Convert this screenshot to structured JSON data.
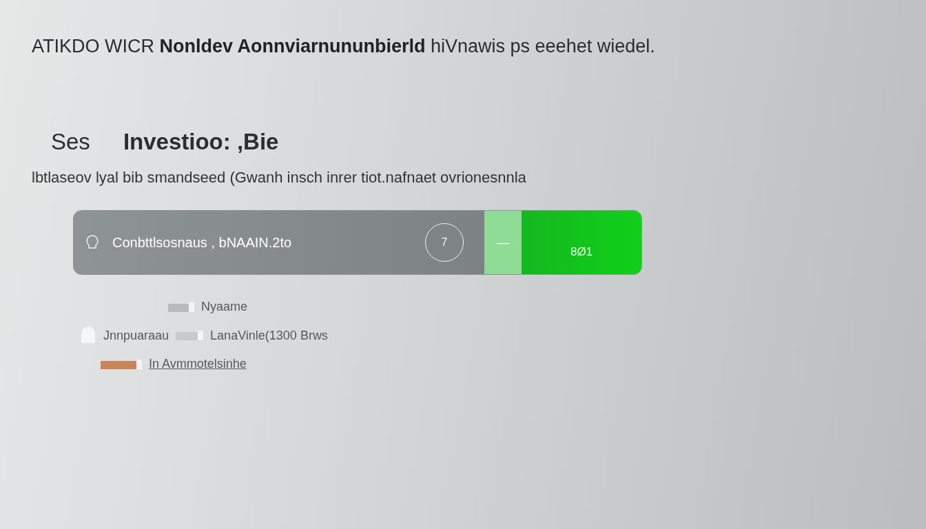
{
  "headline": "ATIKDO WICR **Nonldev Aonnviarnununbierld** hiVnawis ps eeehet wiedel.",
  "heading": {
    "left": "Ses",
    "right": "Investioo: ,Bie"
  },
  "subtitle": "lbtlaseov lyal bib smandseed (Gwanh insch inrer tiot.nafnaet ovrionesnnla",
  "bar": {
    "value": "Conbttlsosnaus , bNAAIN.2to",
    "badge": "7",
    "toggle_label": "—",
    "button_label": "8Ø1"
  },
  "items": [
    {
      "kind": "plain",
      "label": "Nyaame"
    },
    {
      "kind": "double",
      "label": "Jnnpuaraau",
      "detail": "LanaVinle(1300 Brws"
    },
    {
      "kind": "link",
      "label": "In Avmmotelsinhe"
    }
  ]
}
